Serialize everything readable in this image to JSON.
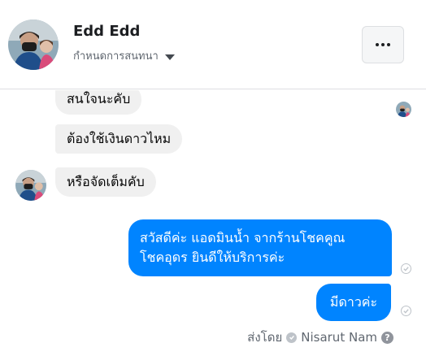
{
  "header": {
    "name": "Edd Edd",
    "subtitle": "กำหนดการสนทนา",
    "more_icon": "more-dots-icon"
  },
  "messages": {
    "incoming": [
      {
        "text": "สนใจนะคับ"
      },
      {
        "text": "ต้องใช้เงินดาวไหม"
      },
      {
        "text": "หรือจัดเต็มคับ"
      }
    ],
    "outgoing": [
      {
        "line1": "สวัสดีค่ะ แอดมินน้ำ จากร้านโชคคูณ",
        "line2": "โชคอุดร ยินดีให้บริการค่ะ",
        "status_icon": "sent-check-icon"
      },
      {
        "text": "มีดาวค่ะ",
        "status_icon": "sent-check-icon"
      }
    ],
    "sent_by_label": "ส่งโดย",
    "sent_by_name": "Nisarut Nam",
    "help_glyph": "?"
  },
  "colors": {
    "outgoing_bubble": "#0084ff",
    "incoming_bubble": "#f0f0f0"
  }
}
